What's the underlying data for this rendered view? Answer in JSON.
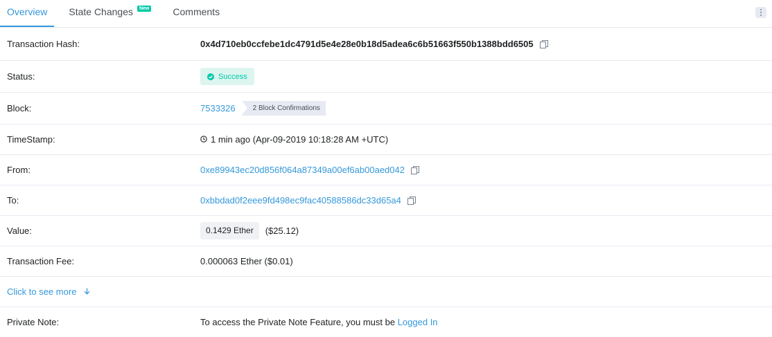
{
  "tabs": [
    {
      "label": "Overview"
    },
    {
      "label": "State Changes",
      "badge": "New"
    },
    {
      "label": "Comments"
    }
  ],
  "rows": {
    "tx_hash": {
      "label": "Transaction Hash:",
      "value": "0x4d710eb0ccfebe1dc4791d5e4e28e0b18d5adea6c6b51663f550b1388bdd6505"
    },
    "status": {
      "label": "Status:",
      "value": "Success"
    },
    "block": {
      "label": "Block:",
      "value": "7533326",
      "confirmations": "2 Block Confirmations"
    },
    "timestamp": {
      "label": "TimeStamp:",
      "value": "1 min ago (Apr-09-2019 10:18:28 AM +UTC)"
    },
    "from": {
      "label": "From:",
      "value": "0xe89943ec20d856f064a87349a00ef6ab00aed042"
    },
    "to": {
      "label": "To:",
      "value": "0xbbdad0f2eee9fd498ec9fac40588586dc33d65a4"
    },
    "value": {
      "label": "Value:",
      "amount": "0.1429 Ether",
      "usd": "($25.12)"
    },
    "fee": {
      "label": "Transaction Fee:",
      "value": "0.000063 Ether ($0.01)"
    },
    "see_more": {
      "label": "Click to see more"
    },
    "private_note": {
      "label": "Private Note:",
      "text": "To access the Private Note Feature, you must be ",
      "link": "Logged In"
    }
  },
  "colors": {
    "accent": "#3498db",
    "success": "#00c9a7",
    "border": "#e7eaf3"
  }
}
